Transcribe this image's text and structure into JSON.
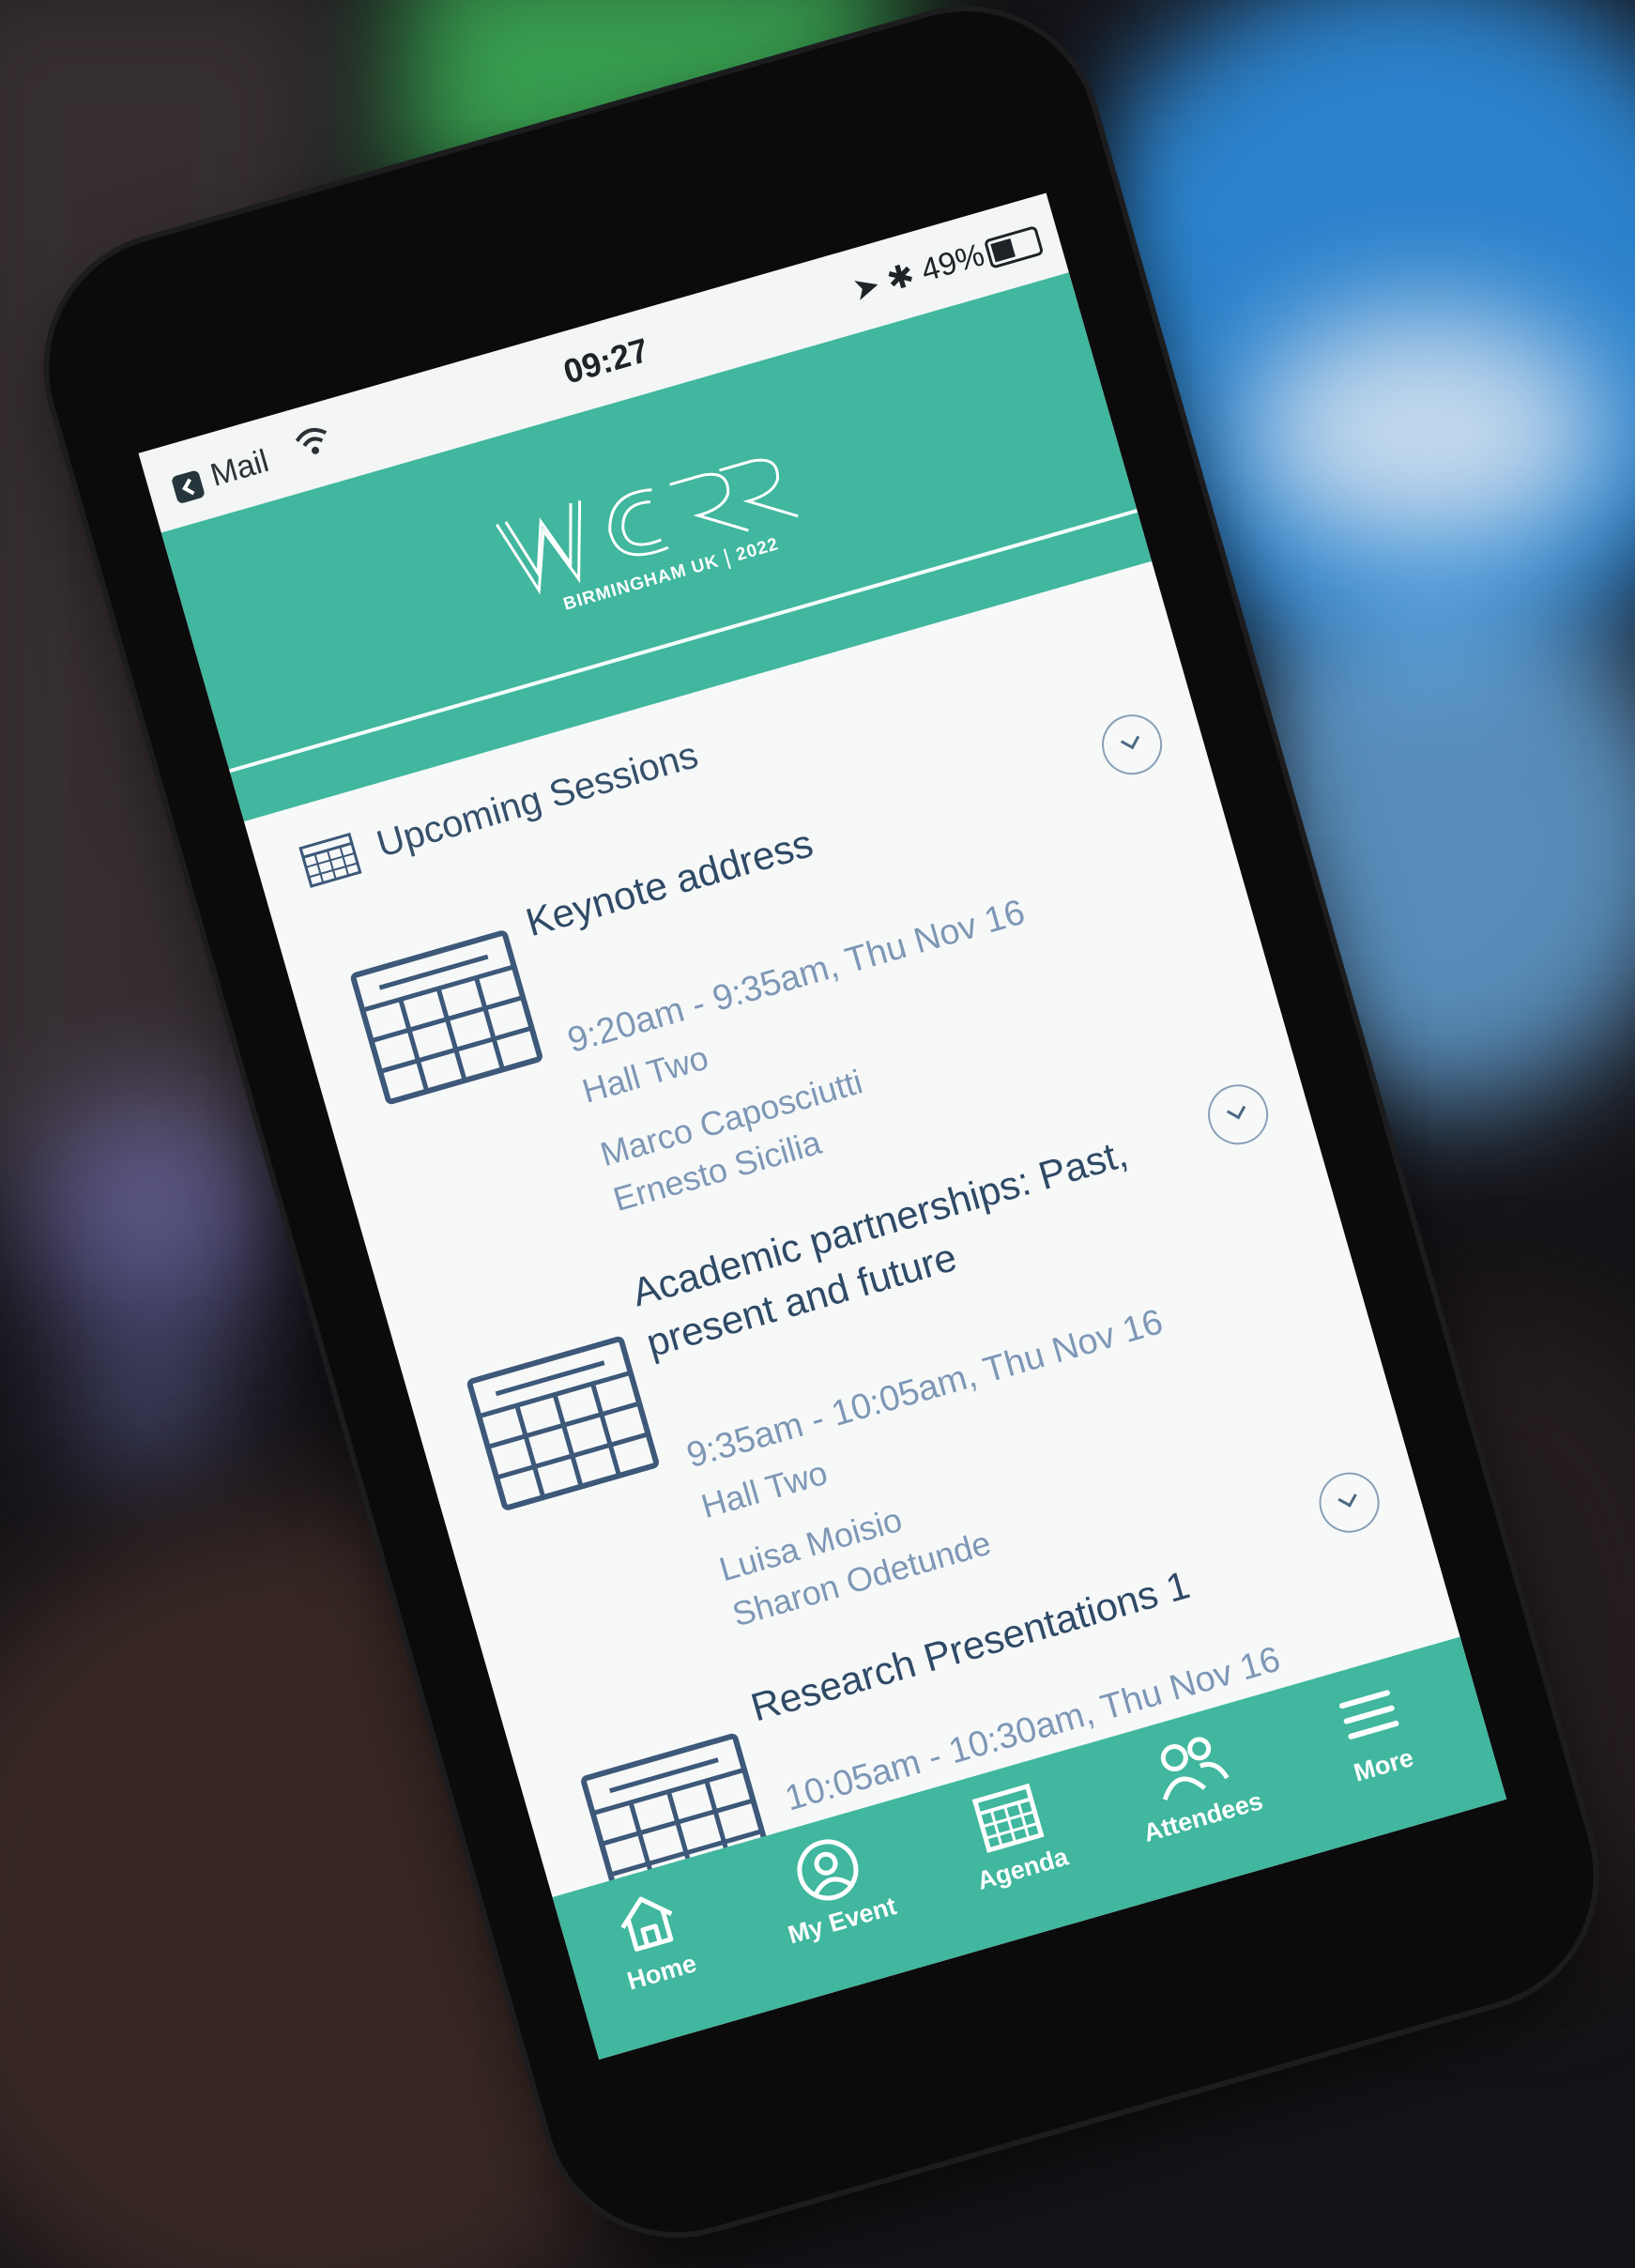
{
  "status_bar": {
    "back_app": "Mail",
    "time": "09:27",
    "battery": "49%"
  },
  "header": {
    "logo_text": "WCRR",
    "location": "BIRMINGHAM UK",
    "year": "2022",
    "brand_color": "#40b79e"
  },
  "main": {
    "section_title": "Upcoming Sessions",
    "sessions": [
      {
        "title": "Keynote address",
        "time": "9:20am - 9:35am, Thu Nov 16",
        "room": "Hall Two",
        "speakers": [
          "Marco Caposciutti",
          "Ernesto Sicilia"
        ]
      },
      {
        "title_line1": "Academic partnerships: Past,",
        "title_line2": "present and future",
        "time": "9:35am - 10:05am, Thu Nov 16",
        "room": "Hall Two",
        "speakers": [
          "Luisa Moisio",
          "Sharon Odetunde"
        ]
      },
      {
        "title": "Research Presentations 1",
        "time": "10:05am - 10:30am, Thu Nov 16"
      }
    ]
  },
  "tab_bar": {
    "items": [
      {
        "label": "Home",
        "icon": "home-icon"
      },
      {
        "label": "My Event",
        "icon": "user-circle-icon"
      },
      {
        "label": "Agenda",
        "icon": "calendar-icon"
      },
      {
        "label": "Attendees",
        "icon": "people-icon"
      },
      {
        "label": "More",
        "icon": "menu-icon"
      }
    ]
  }
}
